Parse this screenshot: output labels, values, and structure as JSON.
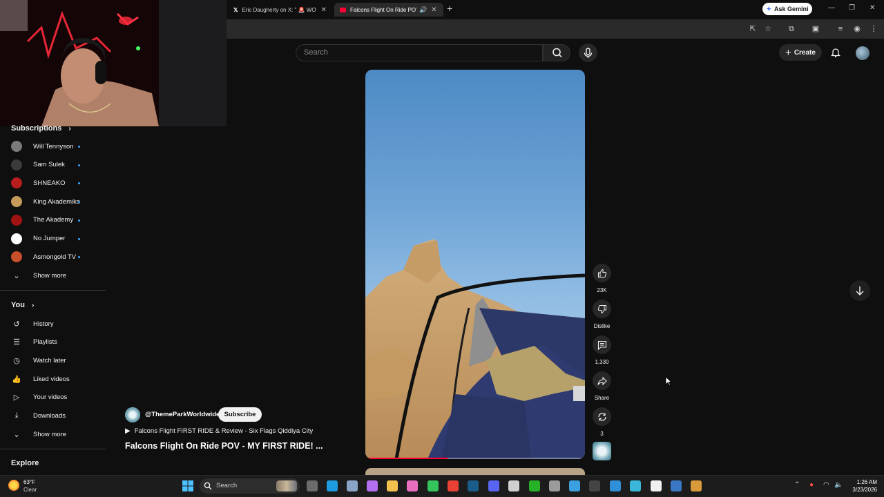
{
  "browser": {
    "tabs": [
      {
        "title": "Eric Daugherty on X: \" 🚨 WOW",
        "active": false
      },
      {
        "title": "Falcons Flight On Ride POV",
        "active": true
      }
    ],
    "ask_gemini_label": "Ask Gemini"
  },
  "header": {
    "search_placeholder": "Search",
    "create_label": "Create"
  },
  "sidebar": {
    "subscriptions_heading": "Subscriptions",
    "subscriptions": [
      {
        "name": "Will Tennyson",
        "color": "#7a7a7a"
      },
      {
        "name": "Sam Sulek",
        "color": "#3a3a3a"
      },
      {
        "name": "SHNEAKO",
        "color": "#b81d1d"
      },
      {
        "name": "King Akademiks",
        "color": "#c69a5a"
      },
      {
        "name": "The Akademy",
        "color": "#a11212"
      },
      {
        "name": "No Jumper",
        "color": "#ffffff"
      },
      {
        "name": "Asmongold TV",
        "color": "#c8502a"
      }
    ],
    "show_more_label_1": "Show more",
    "you_heading": "You",
    "you_items": [
      {
        "label": "History",
        "icon": "history-icon",
        "glyph": "↺"
      },
      {
        "label": "Playlists",
        "icon": "playlists-icon",
        "glyph": "☰"
      },
      {
        "label": "Watch later",
        "icon": "clock-icon",
        "glyph": "◷"
      },
      {
        "label": "Liked videos",
        "icon": "thumb-up-icon",
        "glyph": "👍"
      },
      {
        "label": "Your videos",
        "icon": "video-icon",
        "glyph": "▷"
      },
      {
        "label": "Downloads",
        "icon": "download-icon",
        "glyph": "⤓"
      }
    ],
    "show_more_label_2": "Show more",
    "explore_heading": "Explore"
  },
  "short": {
    "like_count": "23K",
    "dislike_label": "Dislike",
    "comment_count": "1,330",
    "share_label": "Share",
    "remix_count": "3",
    "progress": 0.37,
    "channel": "@ThemeParkWorldwide",
    "subscribe_label": "Subscribe",
    "related_title": "Falcons Flight FIRST RIDE & Review - Six Flags Qiddiya City",
    "title": "Falcons Flight On Ride POV - MY FIRST RIDE! ..."
  },
  "taskbar": {
    "temperature": "63°F",
    "weather": "Clear",
    "search_placeholder": "Search",
    "time": "1:26 AM",
    "date": "3/23/2026"
  }
}
